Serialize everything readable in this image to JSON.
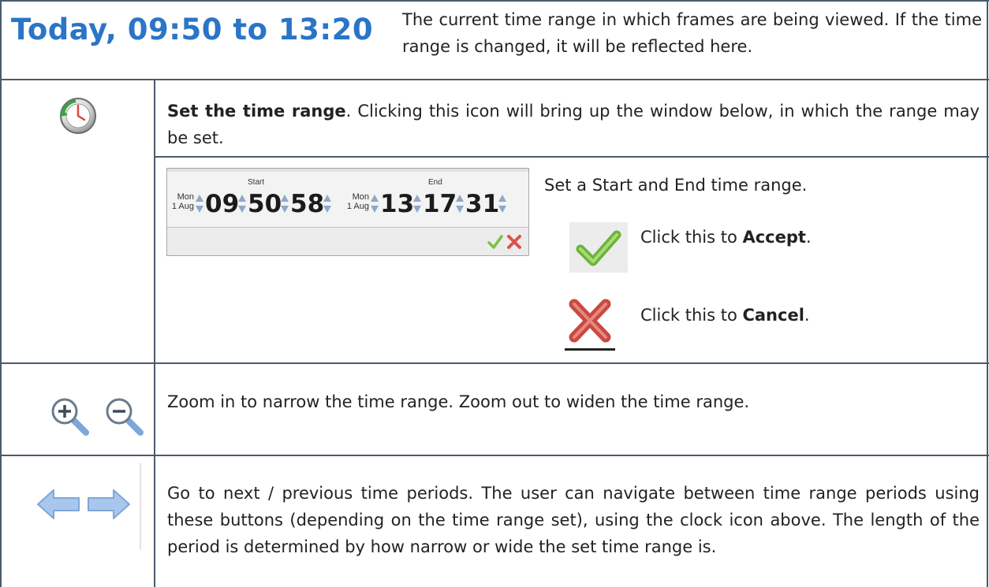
{
  "header": {
    "time_range": "Today, 09:50 to 13:20",
    "description": "The current time range in which frames are being viewed. If the time range is changed, it will be reflected here."
  },
  "set_range": {
    "bold_label": "Set the time range",
    "description": ". Clicking this icon will bring up the window below, in which the range may be set.",
    "icon": "clock-history-icon"
  },
  "picker": {
    "start_label": "Start",
    "end_label": "End",
    "start": {
      "weekday": "Mon",
      "date": "1 Aug",
      "hour": "09",
      "minute": "50",
      "second": "58"
    },
    "end": {
      "weekday": "Mon",
      "date": "1 Aug",
      "hour": "13",
      "minute": "17",
      "second": "31"
    },
    "description": "Set a Start and End time range."
  },
  "accept": {
    "prefix": "Click this to ",
    "bold": "Accept",
    "suffix": ".",
    "icon": "checkmark-icon",
    "color": "#7bc142"
  },
  "cancel": {
    "prefix": "Click this to ",
    "bold": "Cancel",
    "suffix": ".",
    "icon": "red-x-icon",
    "color": "#d9534f"
  },
  "zoom": {
    "description": "Zoom in to narrow the time range. Zoom out to widen the time range.",
    "icons": [
      "zoom-in-icon",
      "zoom-out-icon"
    ]
  },
  "navigate": {
    "description": "Go to next / previous time periods. The user can navigate between time range periods using these buttons (depending on the time range set), using the clock icon above. The length of the period is determined by how narrow or wide the set time range is.",
    "icons": [
      "arrow-left-icon",
      "arrow-right-icon"
    ]
  },
  "colors": {
    "title_blue": "#2a75c7",
    "grid_line": "#4a5a6c",
    "icon_blue": "#7ea7d8"
  }
}
